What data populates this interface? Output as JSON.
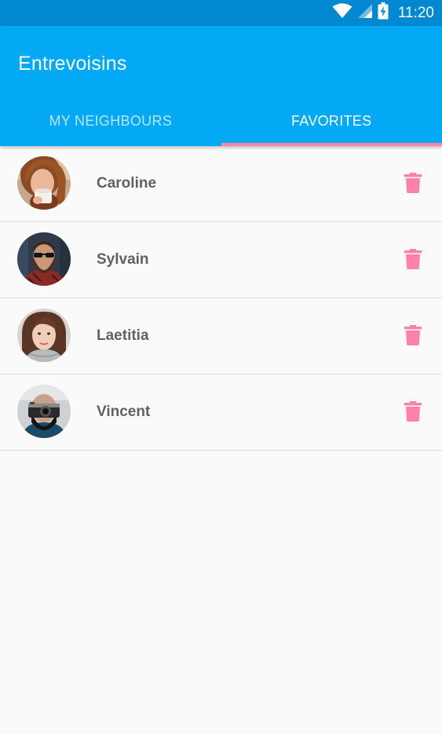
{
  "status_bar": {
    "time": "11:20",
    "icons": [
      "wifi-icon",
      "signal-icon",
      "battery-charging-icon"
    ],
    "color": "#0288d1"
  },
  "app_bar": {
    "title": "Entrevoisins",
    "color": "#03a9f4"
  },
  "tabs": [
    {
      "label": "MY NEIGHBOURS",
      "active": false
    },
    {
      "label": "FAVORITES",
      "active": true
    }
  ],
  "accent_color": "#ff80ab",
  "favorites": [
    {
      "name": "Caroline",
      "avatar": "avatar-caroline",
      "action_icon": "delete-icon"
    },
    {
      "name": "Sylvain",
      "avatar": "avatar-sylvain",
      "action_icon": "delete-icon"
    },
    {
      "name": "Laetitia",
      "avatar": "avatar-laetitia",
      "action_icon": "delete-icon"
    },
    {
      "name": "Vincent",
      "avatar": "avatar-vincent",
      "action_icon": "delete-icon"
    }
  ]
}
